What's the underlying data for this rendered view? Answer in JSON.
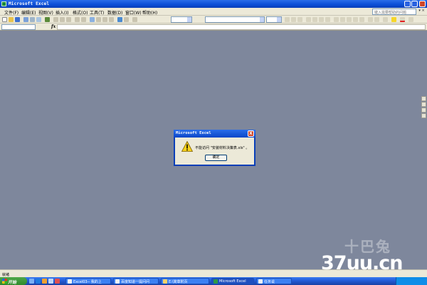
{
  "window": {
    "title": "Microsoft Excel"
  },
  "menu": {
    "items": [
      "文件(F)",
      "编辑(E)",
      "视图(V)",
      "插入(I)",
      "格式(O)",
      "工具(T)",
      "数据(D)",
      "窗口(W)",
      "帮助(H)"
    ],
    "help_placeholder": "键入需要帮助的问题"
  },
  "formula_bar": {
    "fx_label": "fx",
    "namebox_value": "",
    "formula_value": ""
  },
  "dialog": {
    "title": "Microsoft Excel",
    "close_glyph": "X",
    "message": "不能访问 \"安装材料决策表.xls\" 。",
    "ok_label": "确定"
  },
  "status": {
    "text": "就绪"
  },
  "taskbar": {
    "start_label": "开始",
    "tasks": [
      {
        "label": "Excel03-- 我的上"
      },
      {
        "label": "百度知道一提问问"
      },
      {
        "label": "E:\\简章附页"
      },
      {
        "label": "Microsoft Excel"
      },
      {
        "label": "任务说"
      }
    ]
  },
  "watermark": {
    "text": "37uu.cn",
    "logo_text": "十巴兔"
  }
}
